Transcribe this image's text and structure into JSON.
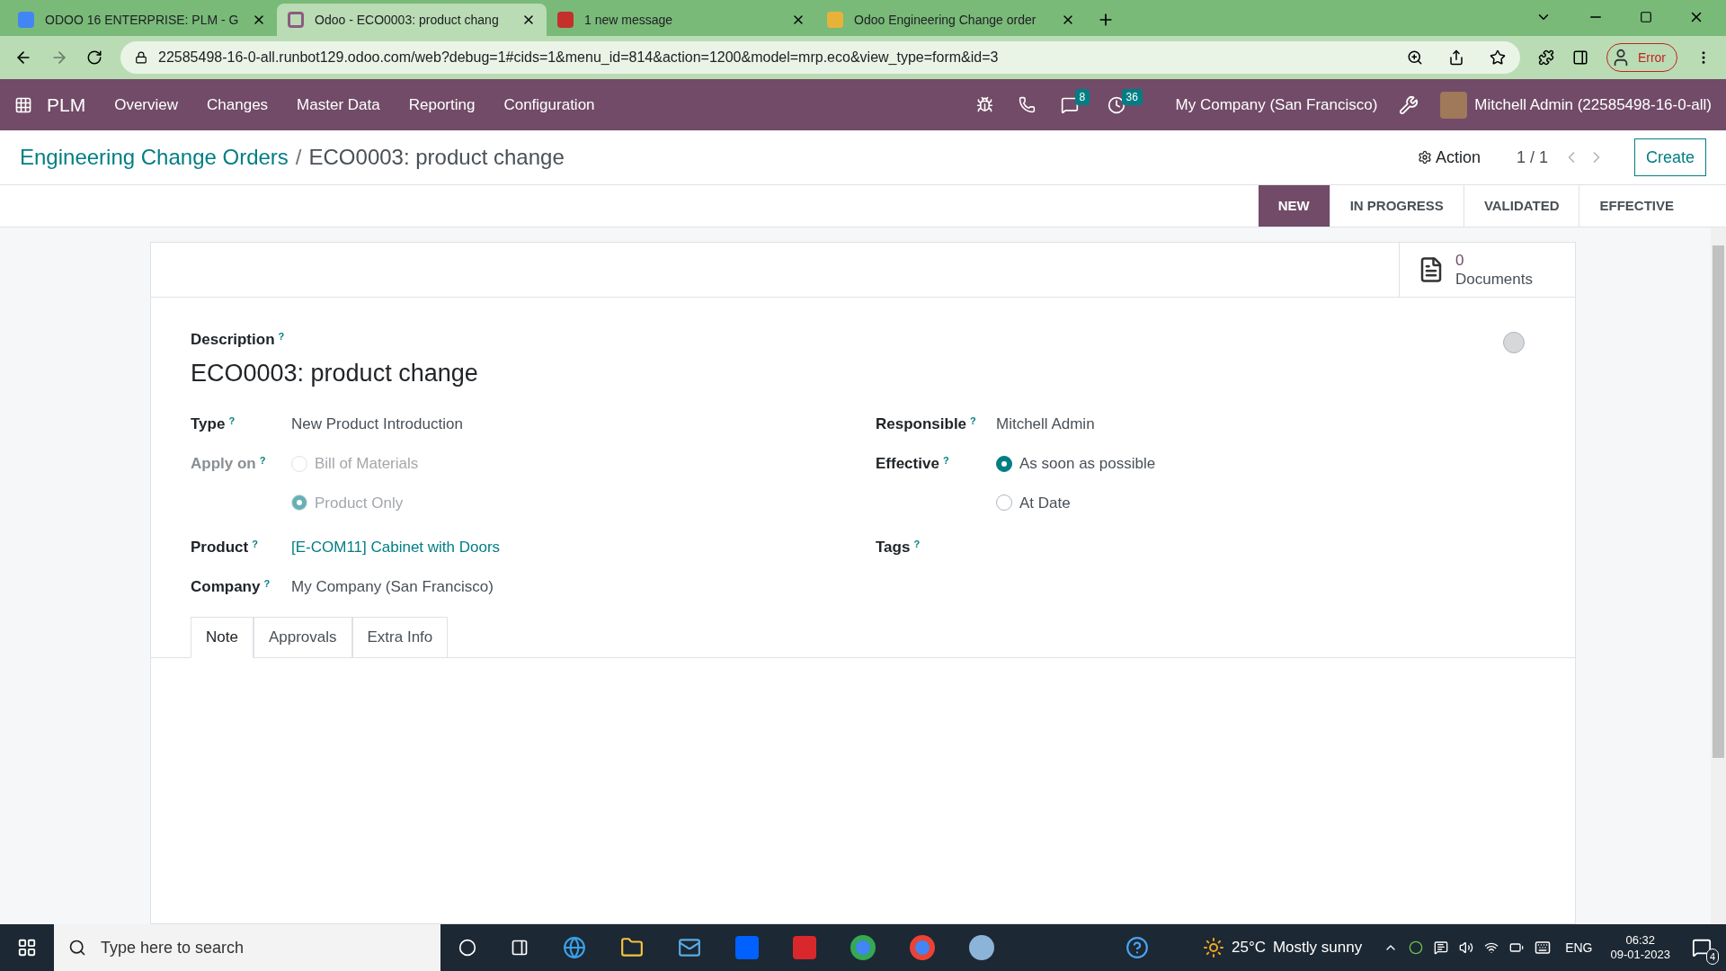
{
  "browser": {
    "tabs": [
      {
        "title": "ODOO 16 ENTERPRISE: PLM - G",
        "selected": false
      },
      {
        "title": "Odoo - ECO0003: product chang",
        "selected": true
      },
      {
        "title": "1 new message",
        "selected": false
      },
      {
        "title": "Odoo Engineering Change order",
        "selected": false
      }
    ],
    "address": "22585498-16-0-all.runbot129.odoo.com/web?debug=1#cids=1&menu_id=814&action=1200&model=mrp.eco&view_type=form&id=3",
    "profile_label": "Error"
  },
  "navbar": {
    "app": "PLM",
    "menus": [
      "Overview",
      "Changes",
      "Master Data",
      "Reporting",
      "Configuration"
    ],
    "messages_count": "8",
    "activities_count": "36",
    "company": "My Company (San Francisco)",
    "user": "Mitchell Admin (22585498-16-0-all)"
  },
  "breadcrumb": [
    "Engineering Change Orders",
    "ECO0003: product change"
  ],
  "breadcrumb_separator": "/",
  "action": "Action",
  "pager": "1 / 1",
  "create": "Create",
  "stages": [
    {
      "label": "NEW",
      "selected": true
    },
    {
      "label": "IN PROGRESS",
      "selected": false
    },
    {
      "label": "VALIDATED",
      "selected": false
    },
    {
      "label": "EFFECTIVE",
      "selected": false
    }
  ],
  "smart_button": {
    "count": "0",
    "label": "Documents"
  },
  "form": {
    "description_label": "Description",
    "help": "?",
    "title": "ECO0003: product change",
    "left_fields": [
      {
        "kind": "text",
        "label": "Type",
        "value": "New Product Introduction"
      },
      {
        "kind": "radio",
        "label": "Apply on",
        "disabled": true,
        "options": [
          {
            "label": "Bill of Materials",
            "selected": false
          },
          {
            "label": "Product Only",
            "selected": true
          }
        ]
      },
      {
        "kind": "link",
        "label": "Product",
        "value": "[E-COM11] Cabinet with Doors"
      },
      {
        "kind": "text",
        "label": "Company",
        "value": "My Company (San Francisco)"
      }
    ],
    "right_fields": [
      {
        "kind": "text",
        "label": "Responsible",
        "value": "Mitchell Admin"
      },
      {
        "kind": "radio",
        "label": "Effective",
        "disabled": false,
        "options": [
          {
            "label": "As soon as possible",
            "selected": true
          },
          {
            "label": "At Date",
            "selected": false
          }
        ]
      },
      {
        "kind": "text",
        "label": "Tags"
      }
    ],
    "tabs": [
      {
        "label": "Note",
        "selected": true
      },
      {
        "label": "Approvals",
        "selected": false
      },
      {
        "label": "Extra Info",
        "selected": false
      }
    ]
  },
  "taskbar": {
    "search_placeholder": "Type here to search",
    "temperature": "25°C",
    "weather": "Mostly sunny",
    "language": "ENG",
    "time": "06:32",
    "date": "09-01-2023",
    "notifications": "4"
  }
}
